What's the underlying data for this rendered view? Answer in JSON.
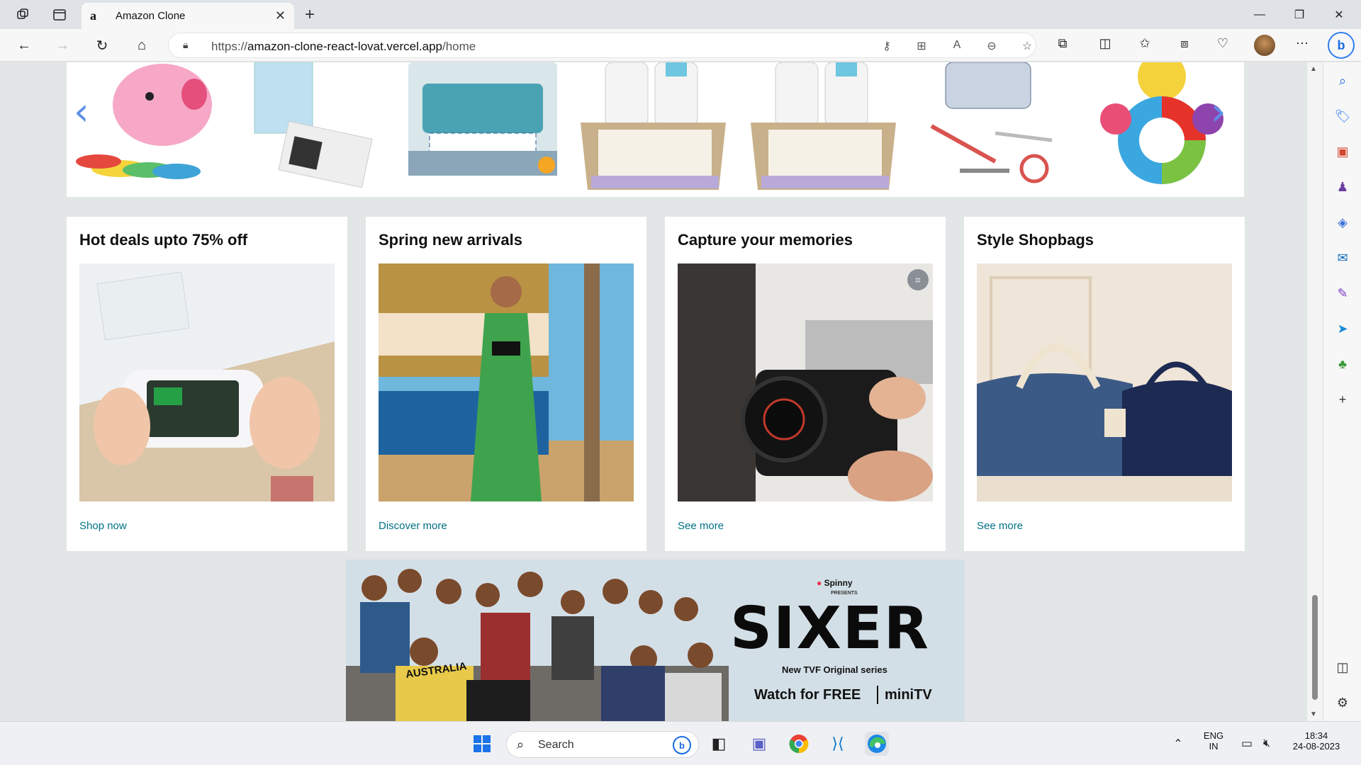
{
  "browser": {
    "tab_title": "Amazon Clone",
    "tab_favicon": "a",
    "url_prefix": "https://",
    "url_host": "amazon-clone-react-lovat.vercel.app",
    "url_path": "/home"
  },
  "carousel": {
    "prev_glyph": "‹",
    "next_glyph": "›",
    "products": [
      {
        "name": "piggy-bank-toy",
        "color": "#f7a9c5"
      },
      {
        "name": "baby-handprint-kit",
        "color": "#cfe3ee"
      },
      {
        "name": "healthcare-grooming-kit",
        "color": "#5aa7b8"
      },
      {
        "name": "aveeno-baby-gift-set",
        "color": "#d8c39a"
      },
      {
        "name": "aveeno-baby-gift-set",
        "color": "#d8c39a"
      },
      {
        "name": "baby-care-kit",
        "color": "#c9d2de"
      },
      {
        "name": "octopus-plush-toy",
        "color": "#f2c94c"
      }
    ]
  },
  "cards": [
    {
      "title": "Hot deals upto 75% off",
      "link": "Shop now"
    },
    {
      "title": "Spring new arrivals",
      "link": "Discover more"
    },
    {
      "title": "Capture your memories",
      "link": "See more"
    },
    {
      "title": "Style Shopbags",
      "link": "See more"
    }
  ],
  "banner": {
    "brand": "Spinny",
    "presents": "PRESENTS",
    "title": "SIXER",
    "subtitle": "New TVF Original series",
    "cta": "Watch for FREE",
    "platform": "miniTV",
    "shirt_text": "AUSTRALIA"
  },
  "taskbar": {
    "search_label": "Search",
    "lang_top": "ENG",
    "lang_bottom": "IN",
    "time": "18:34",
    "date": "24-08-2023"
  },
  "colors": {
    "link": "#007185",
    "page_bg": "#e3e6e6",
    "accent": "#1b6be0"
  }
}
